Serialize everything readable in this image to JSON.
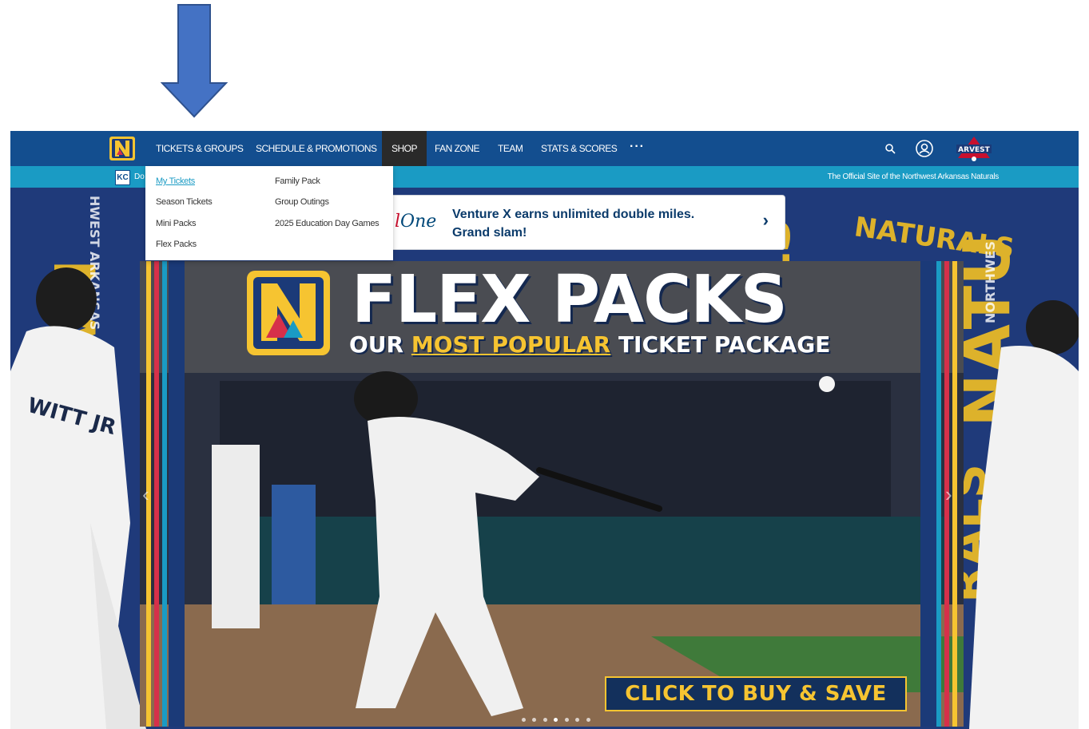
{
  "annotation": {
    "arrow_color": "#4472c4"
  },
  "nav": {
    "logo_icon": "naturals-n-logo",
    "items": [
      {
        "label": "TICKETS & GROUPS"
      },
      {
        "label": "SCHEDULE & PROMOTIONS"
      },
      {
        "label": "SHOP"
      },
      {
        "label": "FAN ZONE"
      },
      {
        "label": "TEAM"
      },
      {
        "label": "STATS & SCORES"
      }
    ],
    "more_label": "···",
    "search_icon": "search-icon",
    "account_icon": "user-circle-icon",
    "sponsor_label": "ARVEST",
    "colors": {
      "bar": "#134e8f",
      "shop_bg": "#2a2a2a",
      "subbar": "#1a9bc4"
    }
  },
  "subbar": {
    "kc_logo": "KC",
    "left_text": "Do",
    "official_text": "The Official Site of the Northwest Arkansas Naturals"
  },
  "dropdown": {
    "col1": [
      {
        "label": "My Tickets",
        "active": true
      },
      {
        "label": "Season Tickets"
      },
      {
        "label": "Mini Packs"
      },
      {
        "label": "Flex Packs"
      }
    ],
    "col2": [
      {
        "label": "Family Pack"
      },
      {
        "label": "Group Outings"
      },
      {
        "label": "2025 Education Day Games"
      }
    ]
  },
  "ad": {
    "logo_text_partial": "l",
    "logo_text_one": "One",
    "text": "Venture X earns unlimited double miles. Grand slam!",
    "chevron": "›"
  },
  "hero": {
    "title": "FLEX PACKS",
    "subtitle_pre": "OUR ",
    "subtitle_highlight": "MOST POPULAR",
    "subtitle_post": " TICKET PACKAGE",
    "cta": "CLICK TO BUY & SAVE",
    "prev": "‹",
    "next": "›",
    "slide_count": 7,
    "active_slide": 4,
    "colors": {
      "gold": "#f6c431",
      "navy": "#13305c"
    }
  }
}
